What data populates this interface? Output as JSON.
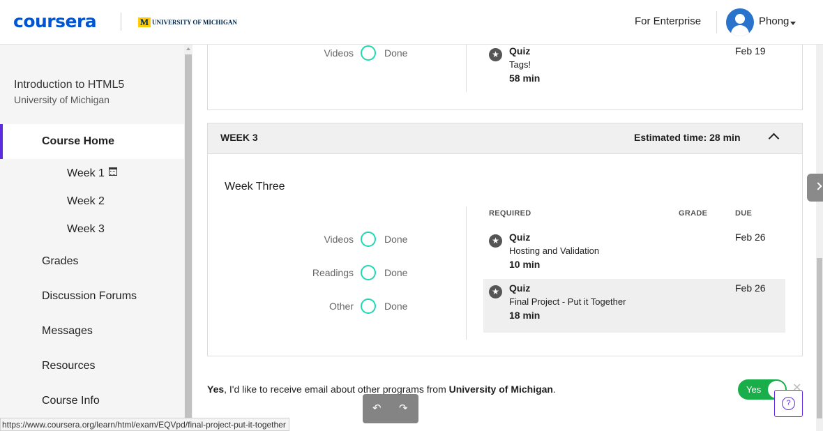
{
  "header": {
    "logo": "coursera",
    "partner_logo": "UNIVERSITY OF MICHIGAN",
    "enterprise_link": "For Enterprise",
    "username": "Phong"
  },
  "sidebar": {
    "course_title": "Introduction to HTML5",
    "course_university": "University of Michigan",
    "items": [
      {
        "label": "Course Home",
        "active": true
      },
      {
        "label": "Week 1",
        "icon": "calendar-icon"
      },
      {
        "label": "Week 2"
      },
      {
        "label": "Week 3"
      },
      {
        "label": "Grades"
      },
      {
        "label": "Discussion Forums"
      },
      {
        "label": "Messages"
      },
      {
        "label": "Resources"
      },
      {
        "label": "Course Info"
      }
    ]
  },
  "week2_partial": {
    "progress": [
      {
        "label": "Videos",
        "status": "Done"
      }
    ],
    "items": [
      {
        "type": "Quiz",
        "title": "Tags!",
        "duration": "58 min",
        "due": "Feb 19"
      }
    ]
  },
  "week3": {
    "header": "WEEK 3",
    "estimated_time": "Estimated time: 28 min",
    "name": "Week Three",
    "progress": [
      {
        "label": "Videos",
        "status": "Done"
      },
      {
        "label": "Readings",
        "status": "Done"
      },
      {
        "label": "Other",
        "status": "Done"
      }
    ],
    "columns": {
      "required": "REQUIRED",
      "grade": "GRADE",
      "due": "DUE"
    },
    "items": [
      {
        "type": "Quiz",
        "title": "Hosting and Validation",
        "duration": "10 min",
        "due": "Feb 26"
      },
      {
        "type": "Quiz",
        "title": "Final Project - Put it Together",
        "duration": "18 min",
        "due": "Feb 26"
      }
    ]
  },
  "consent": {
    "yes_word": "Yes",
    "text_mid": ", I'd like to receive email about other programs from ",
    "university": "University of Michigan",
    "end": ".",
    "toggle_label": "Yes",
    "toggle_on": true
  },
  "help_label": "?",
  "status_url": "https://www.coursera.org/learn/html/exam/EQVpd/final-project-put-it-together",
  "colors": {
    "accent": "#5e2ce0",
    "progress_ring": "#1fd9b3",
    "toggle_on": "#1aae4a",
    "brand": "#0056d2"
  }
}
